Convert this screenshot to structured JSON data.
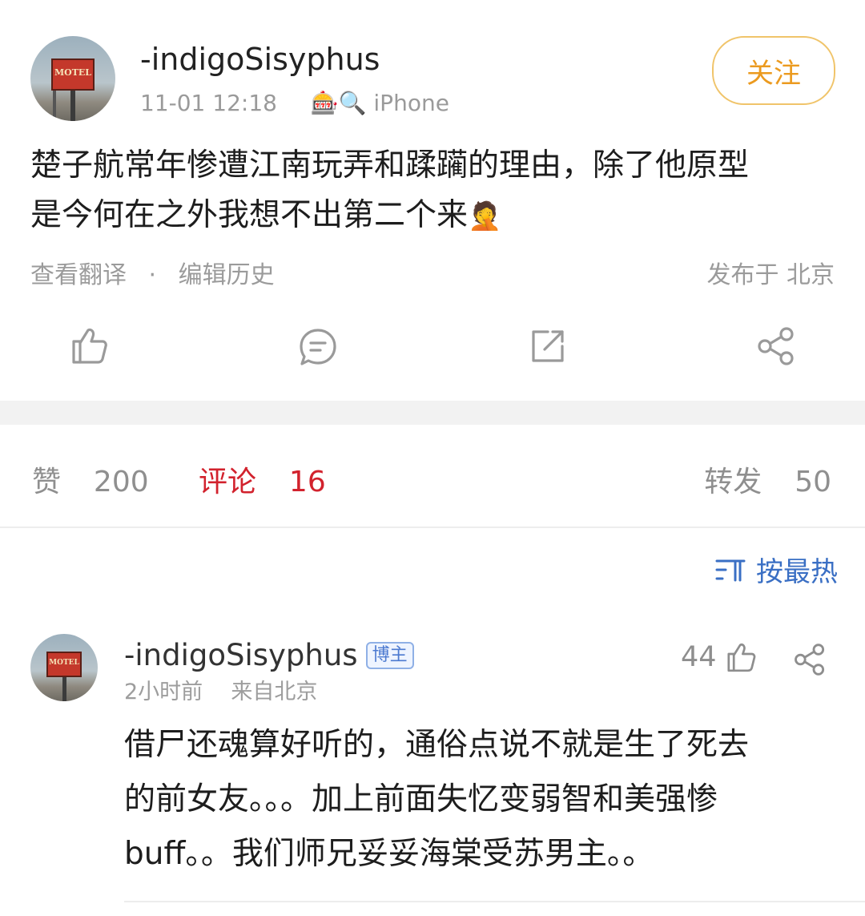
{
  "post": {
    "author": "-indigoSisyphus",
    "time": "11-01 12:18",
    "device_emoji": "🎰🔍",
    "device": "iPhone",
    "follow_label": "关注",
    "text_line1": "楚子航常年惨遭江南玩弄和蹂躏的理由，除了他原型",
    "text_line2": "是今何在之外我想不出第二个来",
    "translate_label": "查看翻译",
    "separator": "·",
    "edit_history_label": "编辑历史",
    "location": "发布于 北京",
    "avatar_sign_text": "MOTEL"
  },
  "actions": {
    "like_icon": "thumbs-up-icon",
    "comment_icon": "comment-icon",
    "repost_icon": "repost-icon",
    "share_icon": "share-icon"
  },
  "stats": {
    "likes_label": "赞",
    "likes_count": "200",
    "comments_label": "评论",
    "comments_count": "16",
    "reposts_label": "转发",
    "reposts_count": "50"
  },
  "sort": {
    "icon": "sort-icon",
    "label": "按最热"
  },
  "comment": {
    "author": "-indigoSisyphus",
    "badge": "博主",
    "time": "2小时前",
    "from": "来自北京",
    "like_count": "44",
    "text_line1": "借尸还魂算好听的，通俗点说不就是生了死去",
    "text_line2": "的前女友。。。加上前面失忆变弱智和美强惨",
    "text_line3": "buff。。我们师兄妥妥海棠受苏男主。。"
  },
  "colors": {
    "accent_orange": "#eb9a1f",
    "active_red": "#d2222d",
    "link_blue": "#3a6fc4"
  }
}
